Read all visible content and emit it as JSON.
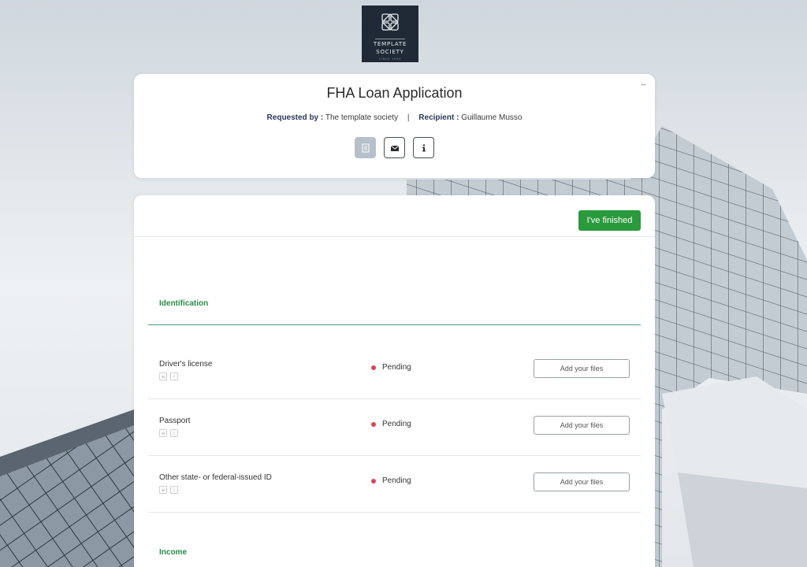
{
  "brand": {
    "logo_line1": "TEMPLATE",
    "logo_line2": "SOCIETY",
    "logo_sub": "SINCE 1990",
    "icon": "knot-logo-icon"
  },
  "header": {
    "title": "FHA Loan Application",
    "requested_by_label": "Requested by :",
    "requested_by_value": "The template society",
    "separator": "|",
    "recipient_label": "Recipient :",
    "recipient_value": "Guillaume Musso",
    "expand_icon": "↔",
    "tools": [
      {
        "name": "document-icon",
        "active": true
      },
      {
        "name": "mail-icon",
        "active": false
      },
      {
        "name": "info-icon",
        "active": false
      }
    ]
  },
  "main": {
    "finish_label": "I've finished",
    "sections": [
      {
        "title": "Identification",
        "items": [
          {
            "name": "Driver's license",
            "status": "Pending",
            "action": "Add your files"
          },
          {
            "name": "Passport",
            "status": "Pending",
            "action": "Add your files"
          },
          {
            "name": "Other state- or federal-issued ID",
            "status": "Pending",
            "action": "Add your files"
          }
        ]
      },
      {
        "title": "Income",
        "items": []
      }
    ]
  },
  "colors": {
    "finish_button": "#2a9a3c",
    "section_title": "#2a8a4a",
    "pending_dot": "#e0405a",
    "logo_bg": "#1f2a36"
  }
}
